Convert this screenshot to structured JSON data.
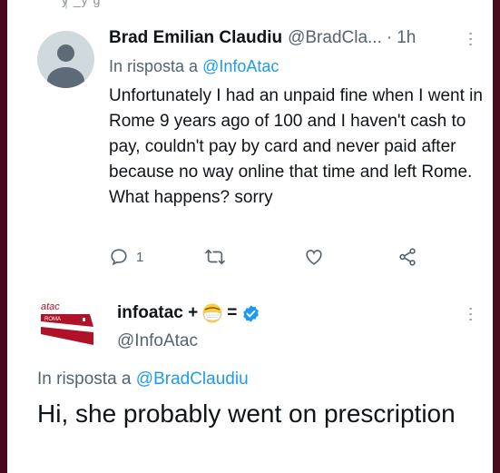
{
  "thread": {
    "top_fragment": "y        _y                    g"
  },
  "reply_tweet": {
    "author_name": "Brad Emilian Claudiu",
    "author_handle": "@BradCla...",
    "separator": "·",
    "timestamp": "1h",
    "reply_prefix": "In risposta a",
    "reply_to": "@InfoAtac",
    "text": "Unfortunately I had an unpaid fine when I went in Rome 9 years ago of 100 and I haven't cash to pay, couldn't pay by card and never paid after because no way online that time and left Rome. What happens? sorry",
    "reply_count": "1",
    "icons": [
      "reply-icon",
      "retweet-icon",
      "like-icon",
      "share-icon",
      "more-icon"
    ]
  },
  "main_tweet": {
    "logo_text_top": "atac",
    "logo_text_bottom": "ROMA",
    "author_name": "infoatac +",
    "name_suffix": "=",
    "author_handle": "@InfoAtac",
    "reply_prefix": "In risposta a",
    "reply_to": "@BradClaudiu",
    "text": "Hi, she probably went on prescription",
    "icons": [
      "mask-emoji-icon",
      "verified-badge-icon",
      "more-icon"
    ]
  },
  "colors": {
    "link": "#1d9bf0",
    "secondary_text": "#536471",
    "background_frame": "#4a0a1e",
    "brand_red": "#b0122a"
  }
}
